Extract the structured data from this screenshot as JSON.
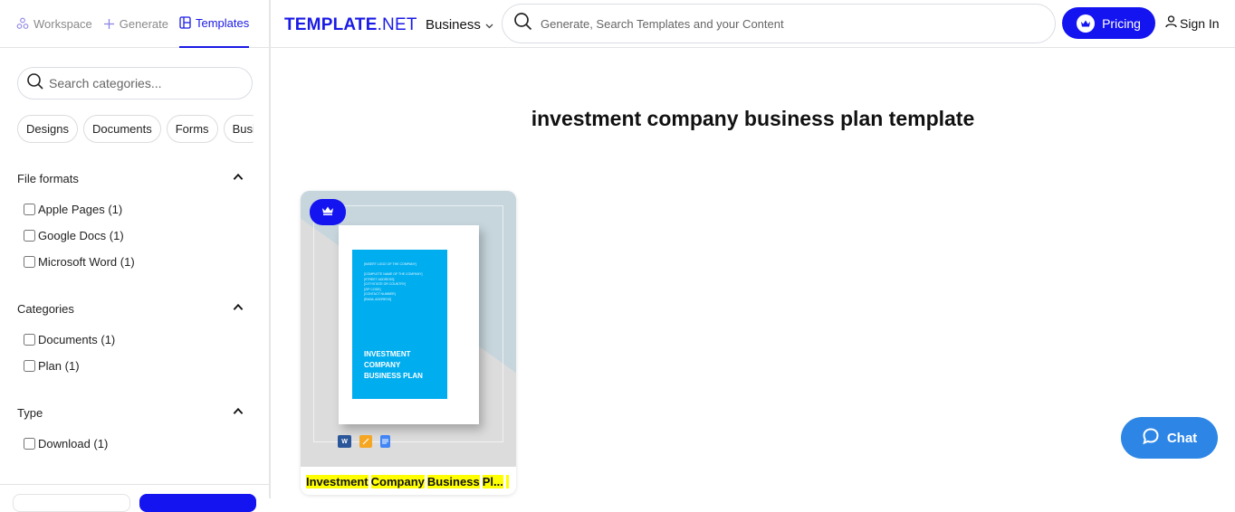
{
  "sidebar": {
    "tabs": [
      {
        "label": "Workspace",
        "icon": "workspace-icon",
        "active": false
      },
      {
        "label": "Generate",
        "icon": "plus-icon",
        "active": false
      },
      {
        "label": "Templates",
        "icon": "templates-icon",
        "active": true
      }
    ],
    "search": {
      "placeholder": "Search categories...",
      "value": ""
    },
    "chips": [
      "Designs",
      "Documents",
      "Forms",
      "Busi"
    ],
    "filters": [
      {
        "title": "File formats",
        "items": [
          "Apple Pages (1)",
          "Google Docs (1)",
          "Microsoft Word (1)"
        ]
      },
      {
        "title": "Categories",
        "items": [
          "Documents (1)",
          "Plan (1)"
        ]
      },
      {
        "title": "Type",
        "items": [
          "Download (1)"
        ]
      }
    ]
  },
  "header": {
    "logo_bold": "TEMPLATE",
    "logo_light": ".NET",
    "category": "Business",
    "search": {
      "placeholder": "Generate, Search Templates and your Content",
      "value": ""
    },
    "pricing_label": "Pricing",
    "signin_label": "Sign In"
  },
  "main": {
    "title": "investment company business plan template",
    "results": [
      {
        "title_words": [
          "Investment",
          "Company",
          "Business",
          "Pl..."
        ],
        "premium": true,
        "formats": [
          "microsoft-word",
          "apple-pages",
          "google-docs"
        ],
        "cover_small_text": "[INSERT LOGO OF THE COMPANY]\n\n[COMPLETE NAME OF THE COMPANY]\n[STREET ADDRESS]\n[CITY/STATE OR COUNTRY]\n[ZIP CODE]\n[CONTACT NUMBER]\n[EMAIL ADDRESS]",
        "cover_title": "INVESTMENT\nCOMPANY\nBUSINESS PLAN"
      }
    ]
  },
  "chat_label": "Chat",
  "colors": {
    "brand": "#1414f0",
    "chat": "#2d86e6",
    "cover": "#00adef",
    "highlight": "#ffff00"
  }
}
